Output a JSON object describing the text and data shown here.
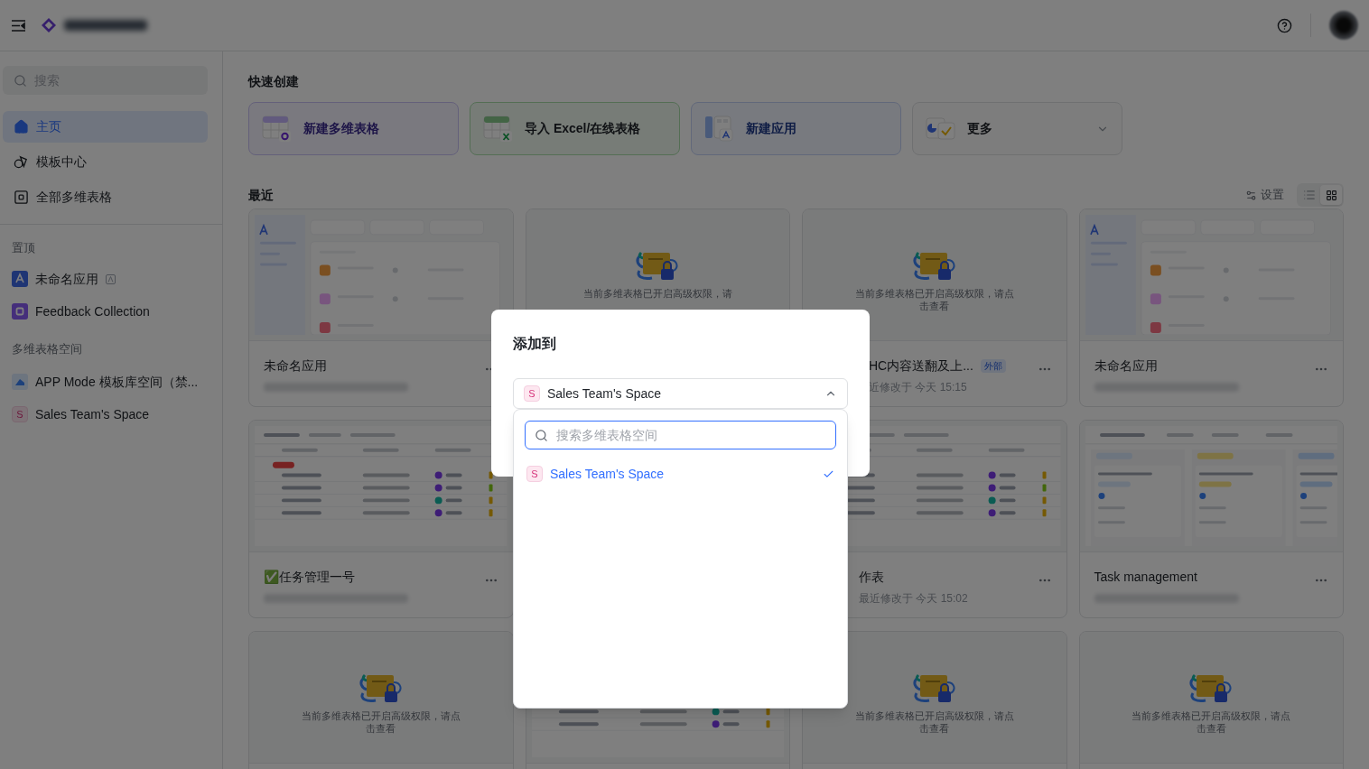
{
  "sidebar": {
    "search": {
      "placeholder": "搜索"
    },
    "nav": [
      {
        "kind": "home",
        "label": "主页",
        "selected": true
      },
      {
        "kind": "templates",
        "label": "模板中心",
        "selected": false
      },
      {
        "kind": "all",
        "label": "全部多维表格",
        "selected": false
      }
    ],
    "pinned_title": "置顶",
    "pinned": [
      {
        "kind": "app",
        "label": "未命名应用"
      },
      {
        "kind": "base",
        "label": "Feedback Collection"
      }
    ],
    "spaces_title": "多维表格空间",
    "spaces": [
      {
        "kind": "image",
        "label": "APP Mode 模板库空间（禁..."
      },
      {
        "kind": "letter",
        "badge": "S",
        "label": "Sales Team's Space"
      }
    ]
  },
  "quick_create": {
    "title": "快速创建",
    "items": [
      {
        "kind": "base",
        "label": "新建多维表格"
      },
      {
        "kind": "excel",
        "label": "导入 Excel/在线表格"
      },
      {
        "kind": "app",
        "label": "新建应用"
      },
      {
        "kind": "more",
        "label": "更多"
      }
    ]
  },
  "recent": {
    "title": "最近",
    "settings": "设置",
    "views": [
      {
        "kind": "list",
        "selected": false
      },
      {
        "kind": "grid",
        "selected": true
      }
    ],
    "rows": [
      [
        {
          "kind": "app",
          "title": "未命名应用"
        },
        {
          "kind": "locked",
          "lock_text": "当前多维表格已开启高级权限，请"
        },
        {
          "kind": "locked",
          "lock_text": "当前多维表格已开启高级权限，请点击查看",
          "title": "HC内容送翻及上...",
          "tag": "外部",
          "modified": "近修改于 今天 15:15"
        },
        {
          "kind": "app",
          "title": "未命名应用"
        }
      ],
      [
        {
          "kind": "table",
          "title": "✅任务管理一号"
        },
        null,
        {
          "kind": "table",
          "title": "作表",
          "modified": "最近修改于 今天 15:02"
        },
        {
          "kind": "kanban",
          "title": "Task management"
        }
      ],
      [
        {
          "kind": "locked",
          "lock_text": "当前多维表格已开启高级权限，请点击查看"
        },
        {
          "kind": "table"
        },
        {
          "kind": "locked",
          "lock_text": "当前多维表格已开启高级权限，请点击查看"
        },
        {
          "kind": "locked",
          "lock_text": "当前多维表格已开启高级权限，请点击查看"
        }
      ]
    ]
  },
  "dialog": {
    "title": "添加到",
    "select": {
      "badge": "S",
      "value": "Sales Team's Space",
      "expanded": true
    },
    "search": {
      "placeholder": "搜索多维表格空间"
    },
    "options": [
      {
        "badge": "S",
        "label": "Sales Team's Space",
        "selected": true
      }
    ]
  }
}
